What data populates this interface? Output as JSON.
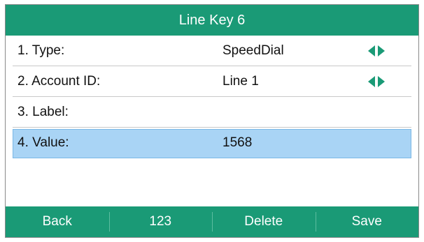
{
  "title": "Line Key 6",
  "rows": [
    {
      "label": "1. Type:",
      "value": "SpeedDial",
      "has_arrows": true
    },
    {
      "label": "2. Account ID:",
      "value": "Line 1",
      "has_arrows": true
    },
    {
      "label": "3. Label:",
      "value": "",
      "has_arrows": false
    },
    {
      "label": "4. Value:",
      "value": "1568",
      "has_arrows": false,
      "selected": true
    }
  ],
  "softkeys": [
    "Back",
    "123",
    "Delete",
    "Save"
  ],
  "colors": {
    "accent": "#1a9a76",
    "highlight": "#a9d4f5"
  },
  "icons": {
    "left_arrow": "arrow-left-icon",
    "right_arrow": "arrow-right-icon"
  }
}
